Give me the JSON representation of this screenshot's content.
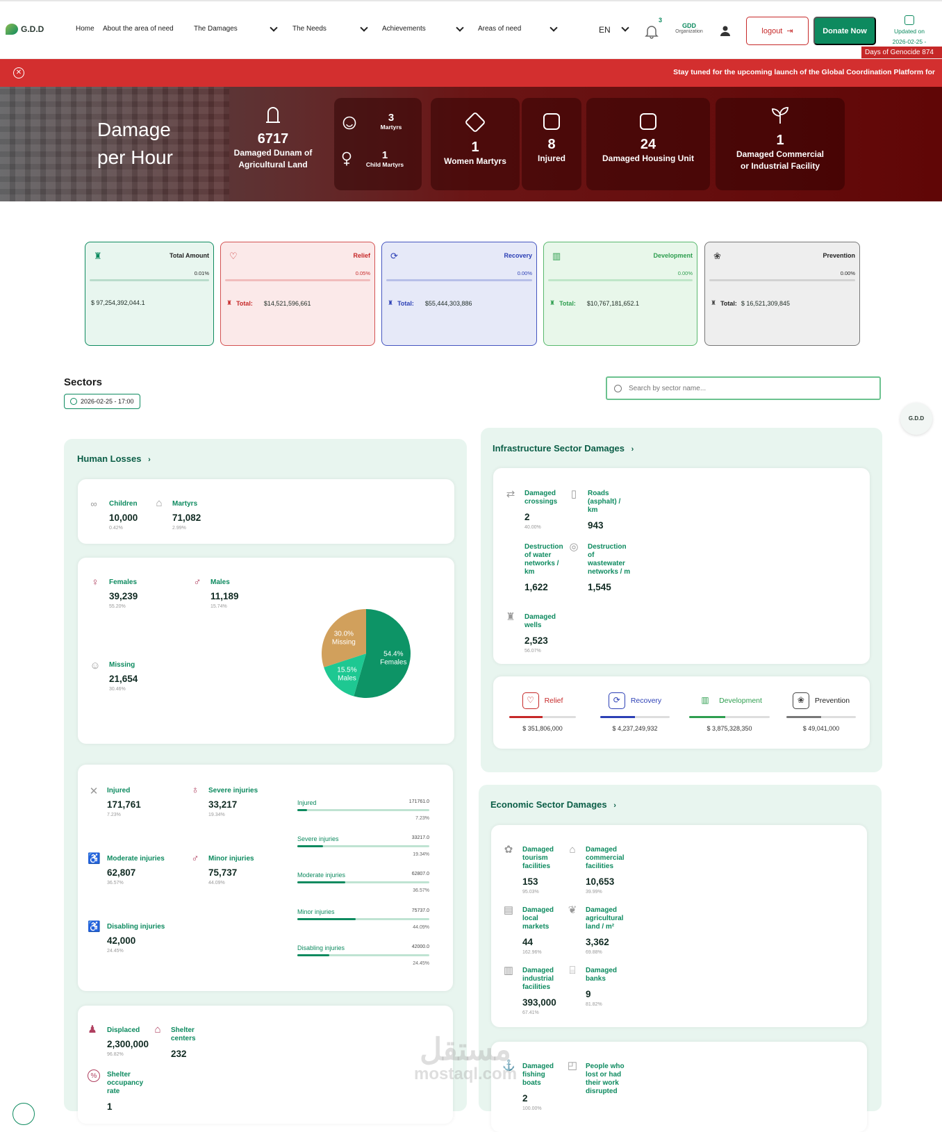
{
  "nav": {
    "logo": "G.D.D",
    "items": [
      "Home",
      "About the area of need",
      "The Damages",
      "The Needs",
      "Achievements",
      "Areas of need"
    ],
    "lang": "EN",
    "notifications": "3",
    "org_name": "GDD",
    "org_label": "Organization",
    "logout": "logout",
    "donate": "Donate Now",
    "updated_label": "Updated on",
    "updated_value": "2026-02-25 - 17:00",
    "days_badge": "Days of Genocide 874"
  },
  "banner": {
    "message": "Stay tuned for the upcoming launch of the Global Coordination Platform for"
  },
  "hero": {
    "title_line1": "Damage",
    "title_line2": "per Hour",
    "agri_value": "6717",
    "agri_label_1": "Damaged Dunam of",
    "agri_label_2": "Agricultural Land",
    "martyrs_value": "3",
    "martyrs_label": "Martyrs",
    "child_value": "1",
    "child_label": "Child Martyrs",
    "women_value": "1",
    "women_label": "Women Martyrs",
    "injured_value": "8",
    "injured_label": "Injured",
    "housing_value": "24",
    "housing_label": "Damaged Housing Unit",
    "commercial_value": "1",
    "commercial_label_1": "Damaged Commercial",
    "commercial_label_2": "or Industrial Facility"
  },
  "summary": [
    {
      "title": "Total Amount",
      "pct": "0.01%",
      "total_label": "",
      "total": "$ 97,254,392,044.1",
      "color": "#0d8a5f"
    },
    {
      "title": "Relief",
      "pct": "0.05%",
      "total_label": "Total:",
      "total": "$14,521,596,661",
      "color": "#c62828"
    },
    {
      "title": "Recovery",
      "pct": "0.00%",
      "total_label": "Total:",
      "total": "$55,444,303,886",
      "color": "#2b3fb5"
    },
    {
      "title": "Development",
      "pct": "0.00%",
      "total_label": "Total:",
      "total": "$10,767,181,652.1",
      "color": "#2e9e4f"
    },
    {
      "title": "Prevention",
      "pct": "0.00%",
      "total_label": "Total:",
      "total": "$ 16,521,309,845",
      "color": "#444444"
    }
  ],
  "sectors": {
    "title": "Sectors",
    "date": "2026-02-25 - 17:00",
    "search_placeholder": "Search by sector name..."
  },
  "human": {
    "title": "Human Losses",
    "children": {
      "label": "Children",
      "value": "10,000",
      "pct": "0.42%"
    },
    "martyrs": {
      "label": "Martyrs",
      "value": "71,082",
      "pct": "2.99%"
    },
    "females": {
      "label": "Females",
      "value": "39,239",
      "pct": "55.20%"
    },
    "males": {
      "label": "Males",
      "value": "11,189",
      "pct": "15.74%"
    },
    "missing": {
      "label": "Missing",
      "value": "21,654",
      "pct": "30.46%"
    },
    "injured": {
      "label": "Injured",
      "value": "171,761",
      "pct": "7.23%"
    },
    "severe": {
      "label": "Severe injuries",
      "value": "33,217",
      "pct": "19.34%"
    },
    "moderate": {
      "label": "Moderate injuries",
      "value": "62,807",
      "pct": "36.57%"
    },
    "minor": {
      "label": "Minor injuries",
      "value": "75,737",
      "pct": "44.09%"
    },
    "disabling": {
      "label": "Disabling injuries",
      "value": "42,000",
      "pct": "24.45%"
    },
    "bars": [
      {
        "label": "Injured",
        "value": "171761.0",
        "pct": "7.23%",
        "frac": 0.0723
      },
      {
        "label": "Severe injuries",
        "value": "33217.0",
        "pct": "19.34%",
        "frac": 0.1934
      },
      {
        "label": "Moderate injuries",
        "value": "62807.0",
        "pct": "36.57%",
        "frac": 0.3657
      },
      {
        "label": "Minor injuries",
        "value": "75737.0",
        "pct": "44.09%",
        "frac": 0.4409
      },
      {
        "label": "Disabling injuries",
        "value": "42000.0",
        "pct": "24.45%",
        "frac": 0.2445
      }
    ],
    "displaced": {
      "label": "Displaced",
      "value": "2,300,000",
      "pct": "96.82%"
    },
    "shelter": {
      "label": "Shelter centers",
      "value": "232"
    },
    "occupancy": {
      "label": "Shelter occupancy rate",
      "value": "1"
    }
  },
  "chart_data": {
    "type": "pie",
    "categories": [
      "Females",
      "Males",
      "Missing"
    ],
    "values": [
      54.4,
      15.5,
      30.0
    ],
    "labels": [
      "54.4%",
      "15.5%",
      "30.0%"
    ],
    "colors": [
      "#0d9466",
      "#1ec892",
      "#d1a05c"
    ]
  },
  "infra": {
    "title": "Infrastructure Sector Damages",
    "crossings": {
      "label": "Damaged crossings",
      "value": "2",
      "pct": "40.00%"
    },
    "roads": {
      "label": "Roads (asphalt) / km",
      "value": "943"
    },
    "water": {
      "label": "Destruction of water networks / km",
      "value": "1,622"
    },
    "wastewater": {
      "label": "Destruction of wastewater networks / m",
      "value": "1,545"
    },
    "wells": {
      "label": "Damaged wells",
      "value": "2,523",
      "pct": "56.07%"
    },
    "funds": [
      {
        "label": "Relief",
        "value": "$ 351,806,000",
        "color": "#c62828"
      },
      {
        "label": "Recovery",
        "value": "$ 4,237,249,932",
        "color": "#2b3fb5"
      },
      {
        "label": "Development",
        "value": "$ 3,875,328,350",
        "color": "#2e9e4f"
      },
      {
        "label": "Prevention",
        "value": "$ 49,041,000",
        "color": "#444444"
      }
    ]
  },
  "econ": {
    "title": "Economic Sector Damages",
    "tourism": {
      "label": "Damaged tourism facilities",
      "value": "153",
      "pct": "95.03%"
    },
    "commercial": {
      "label": "Damaged commercial facilities",
      "value": "10,653",
      "pct": "39.99%"
    },
    "markets": {
      "label": "Damaged local markets",
      "value": "44",
      "pct": "162.96%"
    },
    "agri": {
      "label": "Damaged agricultural land / m²",
      "value": "3,362",
      "pct": "69.88%"
    },
    "industrial": {
      "label": "Damaged industrial facilities",
      "value": "393,000",
      "pct": "67.41%"
    },
    "banks": {
      "label": "Damaged banks",
      "value": "9",
      "pct": "81.82%"
    },
    "boats": {
      "label": "Damaged fishing boats",
      "value": "2",
      "pct": "100.00%"
    },
    "work": {
      "label": "People who lost or had their work disrupted"
    }
  },
  "watermark": {
    "line1": "مستقل",
    "line2": "mostaql.com"
  }
}
